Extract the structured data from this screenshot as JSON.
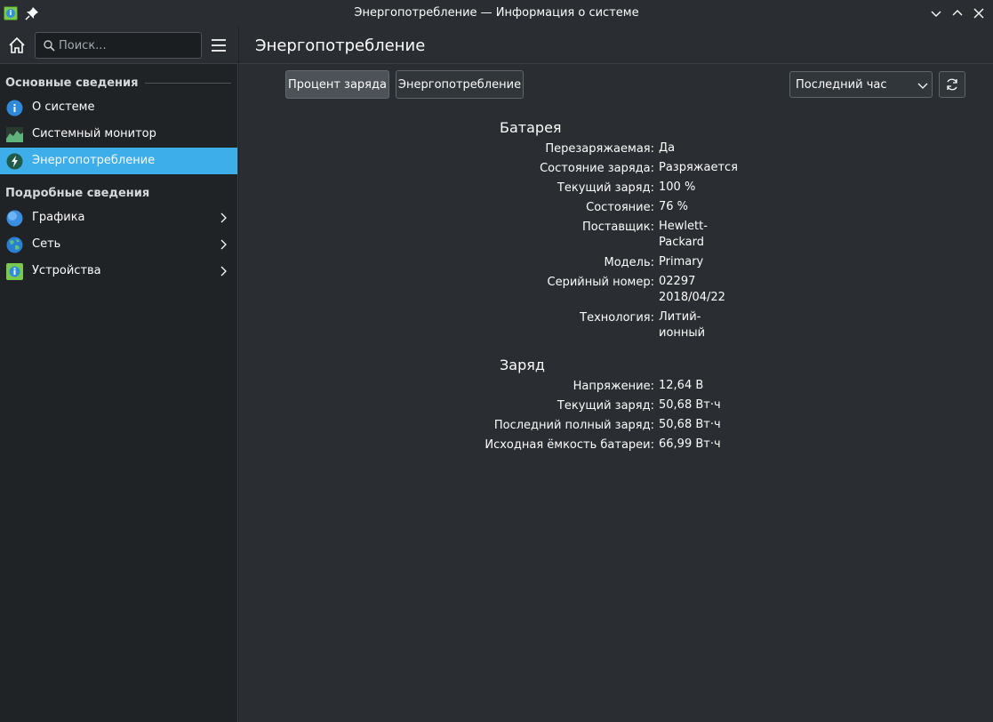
{
  "window": {
    "title": "Энергопотребление — Информация о системе"
  },
  "search": {
    "placeholder": "Поиск..."
  },
  "sidebar": {
    "sections": [
      {
        "title": "Основные сведения"
      },
      {
        "title": "Подробные сведения"
      }
    ],
    "items": [
      {
        "label": "О системе",
        "icon": "info-icon"
      },
      {
        "label": "Системный монитор",
        "icon": "system-monitor-icon"
      },
      {
        "label": "Энергопотребление",
        "icon": "energy-icon",
        "active": true
      },
      {
        "label": "Графика",
        "icon": "graphics-icon"
      },
      {
        "label": "Сеть",
        "icon": "network-icon"
      },
      {
        "label": "Устройства",
        "icon": "devices-icon"
      }
    ]
  },
  "main": {
    "title": "Энергопотребление",
    "toolbar": {
      "charge_percent_label": "Процент заряда",
      "energy_label": "Энергопотребление",
      "time_range": "Последний час"
    },
    "battery": {
      "title": "Батарея",
      "rows": [
        {
          "label": "Перезаряжаемая:",
          "value": "Да"
        },
        {
          "label": "Состояние заряда:",
          "value": "Разряжается"
        },
        {
          "label": "Текущий заряд:",
          "value": "100 %"
        },
        {
          "label": "Состояние:",
          "value": "76 %"
        },
        {
          "label": "Поставщик:",
          "value": "Hewlett-\nPackard"
        },
        {
          "label": "Модель:",
          "value": "Primary"
        },
        {
          "label": "Серийный номер:",
          "value": "02297\n2018/04/22"
        },
        {
          "label": "Технология:",
          "value": "Литий-\nионный"
        }
      ]
    },
    "charge": {
      "title": "Заряд",
      "rows": [
        {
          "label": "Напряжение:",
          "value": "12,64 В"
        },
        {
          "label": "Текущий заряд:",
          "value": "50,68 Вт·ч"
        },
        {
          "label": "Последний полный заряд:",
          "value": "50,68 Вт·ч"
        },
        {
          "label": "Исходная ёмкость батареи:",
          "value": "66,99 Вт·ч"
        }
      ]
    }
  },
  "colors": {
    "accent": "#3daee9",
    "background": "#2a2e32",
    "sidebar": "#202326"
  }
}
